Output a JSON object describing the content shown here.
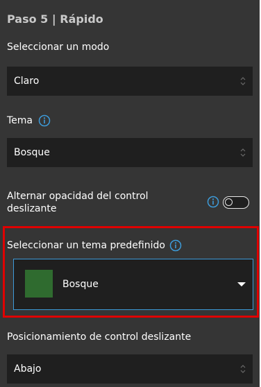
{
  "panel": {
    "step_title": "Paso 5 | Rápido",
    "mode": {
      "label": "Seleccionar un modo",
      "value": "Claro"
    },
    "theme": {
      "label": "Tema",
      "value": "Bosque",
      "info_icon": "info-icon"
    },
    "slider_opacity": {
      "label_line1": "Alternar opacidad del control",
      "label_line2": "deslizante",
      "enabled": false
    },
    "preset": {
      "label": "Seleccionar un tema predefinido",
      "value": "Bosque",
      "swatch_color": "#2f6b2f"
    },
    "slider_position": {
      "label": "Posicionamiento de control deslizante",
      "value": "Abajo"
    }
  },
  "colors": {
    "panel_bg": "#353535",
    "input_bg": "#1f1f1f",
    "accent_blue": "#3d9bd9",
    "highlight_red": "#e00000"
  }
}
